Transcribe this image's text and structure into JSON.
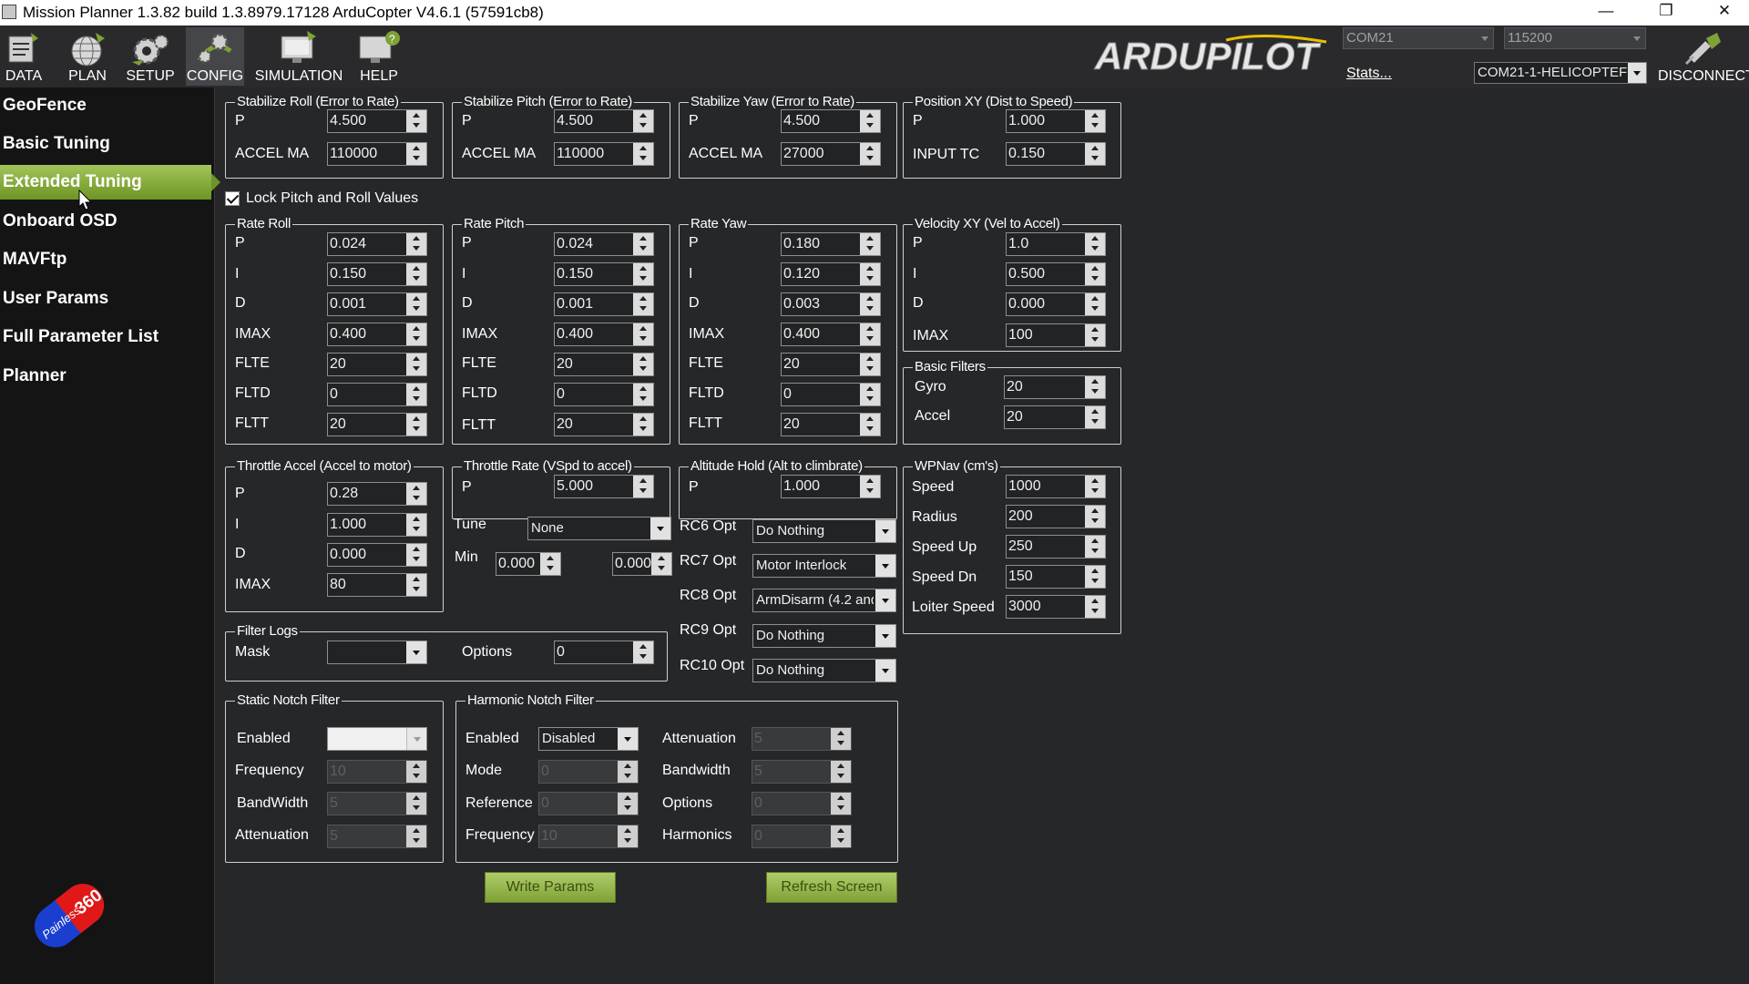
{
  "window": {
    "title": "Mission Planner 1.3.82 build 1.3.8979.17128 ArduCopter V4.6.1 (57591cb8)",
    "minimize": "—",
    "restore": "❐",
    "close": "✕"
  },
  "toolbar": {
    "data": "DATA",
    "plan": "PLAN",
    "setup": "SETUP",
    "config": "CONFIG",
    "simulation": "SIMULATION",
    "help": "HELP",
    "logo": "ARDUPILOT",
    "port": "COM21",
    "baud": "115200",
    "stats": "Stats...",
    "connection": "COM21-1-HELICOPTEF",
    "disconnect": "DISCONNECT"
  },
  "sidebar": {
    "items": [
      "GeoFence",
      "Basic Tuning",
      "Extended Tuning",
      "Onboard OSD",
      "MAVFtp",
      "User Params",
      "Full Parameter List",
      "Planner"
    ],
    "active": "Extended Tuning"
  },
  "groups": {
    "stab_roll": {
      "title": "Stabilize Roll (Error to Rate)",
      "p_label": "P",
      "p": "4.500",
      "accel_label": "ACCEL MA",
      "accel": "110000"
    },
    "stab_pitch": {
      "title": "Stabilize Pitch (Error to Rate)",
      "p_label": "P",
      "p": "4.500",
      "accel_label": "ACCEL MA",
      "accel": "110000"
    },
    "stab_yaw": {
      "title": "Stabilize Yaw (Error to Rate)",
      "p_label": "P",
      "p": "4.500",
      "accel_label": "ACCEL MA",
      "accel": "27000"
    },
    "pos_xy": {
      "title": "Position XY (Dist to Speed)",
      "p_label": "P",
      "p": "1.000",
      "tc_label": "INPUT TC",
      "tc": "0.150"
    },
    "lock_label": "Lock Pitch and Roll Values",
    "rate_roll": {
      "title": "Rate Roll",
      "labels": [
        "P",
        "I",
        "D",
        "IMAX",
        "FLTE",
        "FLTD",
        "FLTT"
      ],
      "values": [
        "0.024",
        "0.150",
        "0.001",
        "0.400",
        "20",
        "0",
        "20"
      ]
    },
    "rate_pitch": {
      "title": "Rate Pitch",
      "labels": [
        "P",
        "I",
        "D",
        "IMAX",
        "FLTE",
        "FLTD",
        "FLTT"
      ],
      "values": [
        "0.024",
        "0.150",
        "0.001",
        "0.400",
        "20",
        "0",
        "20"
      ]
    },
    "rate_yaw": {
      "title": "Rate Yaw",
      "labels": [
        "P",
        "I",
        "D",
        "IMAX",
        "FLTE",
        "FLTD",
        "FLTT"
      ],
      "values": [
        "0.180",
        "0.120",
        "0.003",
        "0.400",
        "20",
        "0",
        "20"
      ]
    },
    "vel_xy": {
      "title": "Velocity XY (Vel to Accel)",
      "labels": [
        "P",
        "I",
        "D",
        "IMAX"
      ],
      "values": [
        "1.0",
        "0.500",
        "0.000",
        "100"
      ]
    },
    "basic_filters": {
      "title": "Basic Filters",
      "labels": [
        "Gyro",
        "Accel"
      ],
      "values": [
        "20",
        "20"
      ]
    },
    "thr_accel": {
      "title": "Throttle Accel (Accel to motor)",
      "labels": [
        "P",
        "I",
        "D",
        "IMAX"
      ],
      "values": [
        "0.28",
        "1.000",
        "0.000",
        "80"
      ]
    },
    "thr_rate": {
      "title": "Throttle Rate (VSpd to accel)",
      "p_label": "P",
      "p": "5.000"
    },
    "tune": {
      "label": "Tune",
      "value": "None",
      "min_label": "Min",
      "min": "0.000",
      "max": "0.000"
    },
    "alt_hold": {
      "title": "Altitude Hold (Alt to climbrate)",
      "p_label": "P",
      "p": "1.000"
    },
    "rc_opts": {
      "labels": [
        "RC6 Opt",
        "RC7 Opt",
        "RC8 Opt",
        "RC9 Opt",
        "RC10 Opt"
      ],
      "values": [
        "Do Nothing",
        "Motor Interlock",
        "ArmDisarm (4.2 and",
        "Do Nothing",
        "Do Nothing"
      ]
    },
    "wpnav": {
      "title": "WPNav (cm's)",
      "labels": [
        "Speed",
        "Radius",
        "Speed Up",
        "Speed Dn",
        "Loiter Speed"
      ],
      "values": [
        "1000",
        "200",
        "250",
        "150",
        "3000"
      ]
    },
    "filter_logs": {
      "title": "Filter Logs",
      "mask_label": "Mask",
      "mask": "",
      "options_label": "Options",
      "options": "0"
    },
    "static_notch": {
      "title": "Static Notch Filter",
      "labels": [
        "Enabled",
        "Frequency",
        "BandWidth",
        "Attenuation"
      ],
      "enabled": "",
      "values": [
        "10",
        "5",
        "5"
      ]
    },
    "harmonic_notch": {
      "title": "Harmonic Notch Filter",
      "left_labels": [
        "Enabled",
        "Mode",
        "Reference",
        "Frequency"
      ],
      "enabled": "Disabled",
      "left_values": [
        "0",
        "0",
        "10"
      ],
      "right_labels": [
        "Attenuation",
        "Bandwidth",
        "Options",
        "Harmonics"
      ],
      "right_values": [
        "5",
        "5",
        "0",
        "0"
      ]
    }
  },
  "buttons": {
    "write": "Write Params",
    "refresh": "Refresh Screen"
  },
  "badge": {
    "text1": "Painless",
    "text2": "360"
  },
  "colors": {
    "accent_green": "#8db343",
    "background": "#262729",
    "sidebar": "#141414"
  }
}
